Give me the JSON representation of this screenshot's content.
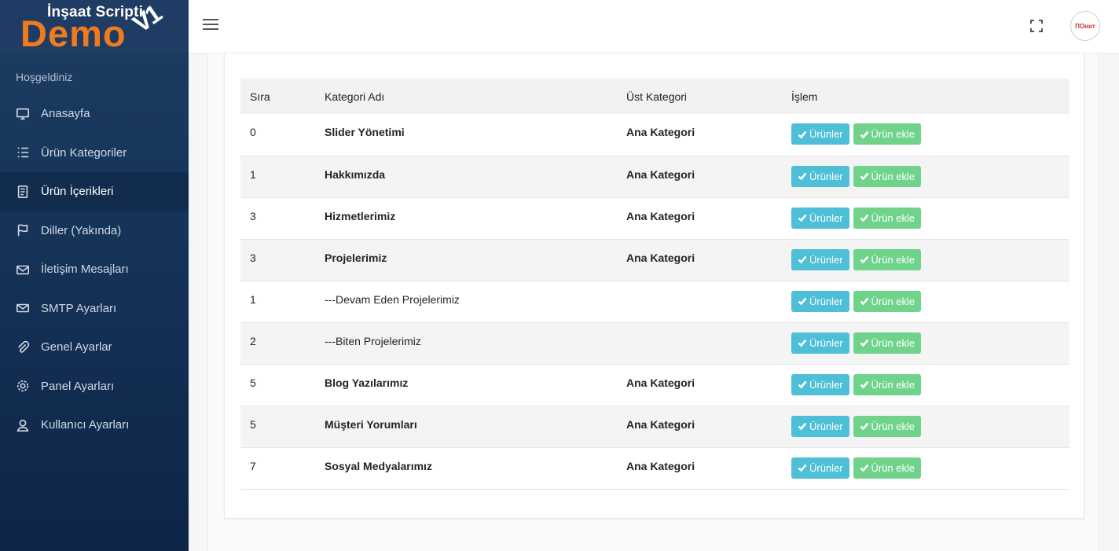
{
  "logo": {
    "small_text": "İnşaat Scripti",
    "big_text": "Demo",
    "version_text": "V1"
  },
  "sidebar": {
    "welcome": "Hoşgeldiniz",
    "items": [
      {
        "label": "Anasayfa",
        "icon": "monitor-icon",
        "active": false
      },
      {
        "label": "Ürün Kategoriler",
        "icon": "list-icon",
        "active": false
      },
      {
        "label": "Ürün İçerikleri",
        "icon": "document-icon",
        "active": true
      },
      {
        "label": "Diller (Yakında)",
        "icon": "flag-icon",
        "active": false
      },
      {
        "label": "İletişim Mesajları",
        "icon": "envelope-icon",
        "active": false
      },
      {
        "label": "SMTP Ayarları",
        "icon": "mail-icon",
        "active": false
      },
      {
        "label": "Genel Ayarlar",
        "icon": "paperclip-icon",
        "active": false
      },
      {
        "label": "Panel Ayarları",
        "icon": "gear-icon",
        "active": false
      },
      {
        "label": "Kullanıcı Ayarları",
        "icon": "user-icon",
        "active": false
      }
    ]
  },
  "topbar": {
    "menu_icon": "hamburger-icon",
    "fullscreen_icon": "fullscreen-icon",
    "avatar_text": "ПОнит"
  },
  "table": {
    "headers": [
      "Sıra",
      "Kategori Adı",
      "Üst Kategori",
      "İşlem"
    ],
    "button_products": "Ürünler",
    "button_add": "Ürün ekle",
    "rows": [
      {
        "sira": "0",
        "name": "Slider Yönetimi",
        "parent": "Ana Kategori",
        "bold": true
      },
      {
        "sira": "1",
        "name": "Hakkımızda",
        "parent": "Ana Kategori",
        "bold": true
      },
      {
        "sira": "3",
        "name": "Hizmetlerimiz",
        "parent": "Ana Kategori",
        "bold": true
      },
      {
        "sira": "3",
        "name": "Projelerimiz",
        "parent": "Ana Kategori",
        "bold": true
      },
      {
        "sira": "1",
        "name": "---Devam Eden Projelerimiz",
        "parent": "",
        "bold": false
      },
      {
        "sira": "2",
        "name": "---Biten Projelerimiz",
        "parent": "",
        "bold": false
      },
      {
        "sira": "5",
        "name": "Blog Yazılarımız",
        "parent": "Ana Kategori",
        "bold": true
      },
      {
        "sira": "5",
        "name": "Müşteri Yorumları",
        "parent": "Ana Kategori",
        "bold": true
      },
      {
        "sira": "7",
        "name": "Sosyal Medyalarımız",
        "parent": "Ana Kategori",
        "bold": true
      }
    ]
  },
  "colors": {
    "sidebar": "#163459",
    "logo_orange": "#f07b1e",
    "btn_info": "#4dbfd6",
    "btn_success": "#6fd38b"
  }
}
